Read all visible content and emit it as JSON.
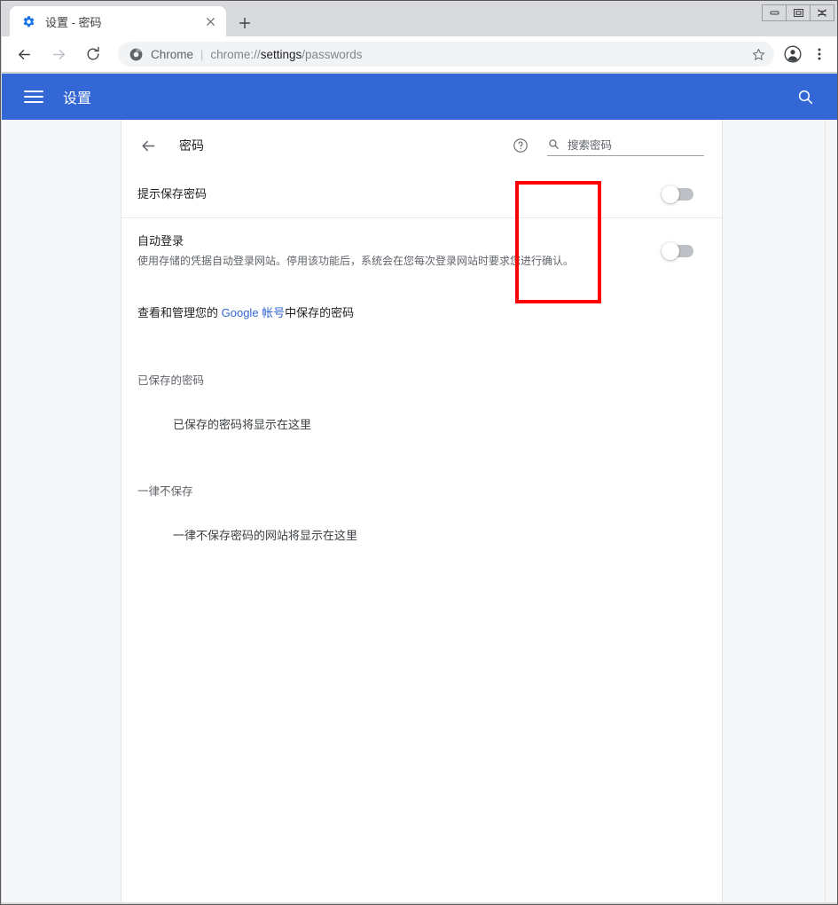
{
  "window": {
    "controls": {
      "minimize_label": "—",
      "maximize_label": "❐",
      "close_label": "✕"
    }
  },
  "browser": {
    "tab": {
      "title": "设置 - 密码",
      "favicon": "settings-gear-icon",
      "close_label": "✕"
    },
    "new_tab_label": "+",
    "nav": {
      "back_label": "←",
      "forward_label": "→",
      "reload_label": "⟳"
    },
    "omnibox": {
      "site_icon": "chrome-logo-icon",
      "scheme_label": "Chrome",
      "separator": "|",
      "url_scheme": "chrome://",
      "url_host": "settings",
      "url_path": "/passwords",
      "star_label": "☆"
    },
    "profile_label": "profile-avatar-icon",
    "menu_label": "⋮"
  },
  "settings_header": {
    "menu_icon": "hamburger-menu-icon",
    "title": "设置",
    "search_icon": "search-icon"
  },
  "passwords_page": {
    "back_label": "←",
    "title": "密码",
    "help_icon": "help-circle-icon",
    "search": {
      "icon": "search-icon",
      "placeholder": "搜索密码",
      "value": ""
    },
    "rows": [
      {
        "label": "提示保存密码",
        "sublabel": "",
        "toggle_state": "off"
      },
      {
        "label": "自动登录",
        "sublabel": "使用存储的凭据自动登录网站。停用该功能后，系统会在您每次登录网站时要求您进行确认。",
        "toggle_state": "off"
      }
    ],
    "account_line": {
      "prefix": "查看和管理您的 ",
      "link": "Google 帐号",
      "suffix": "中保存的密码"
    },
    "sections": [
      {
        "heading": "已保存的密码",
        "empty_text": "已保存的密码将显示在这里"
      },
      {
        "heading": "一律不保存",
        "empty_text": "一律不保存密码的网站将显示在这里"
      }
    ],
    "annotation": {
      "color": "#ff0000",
      "label": "toggle-switches-highlight"
    }
  }
}
